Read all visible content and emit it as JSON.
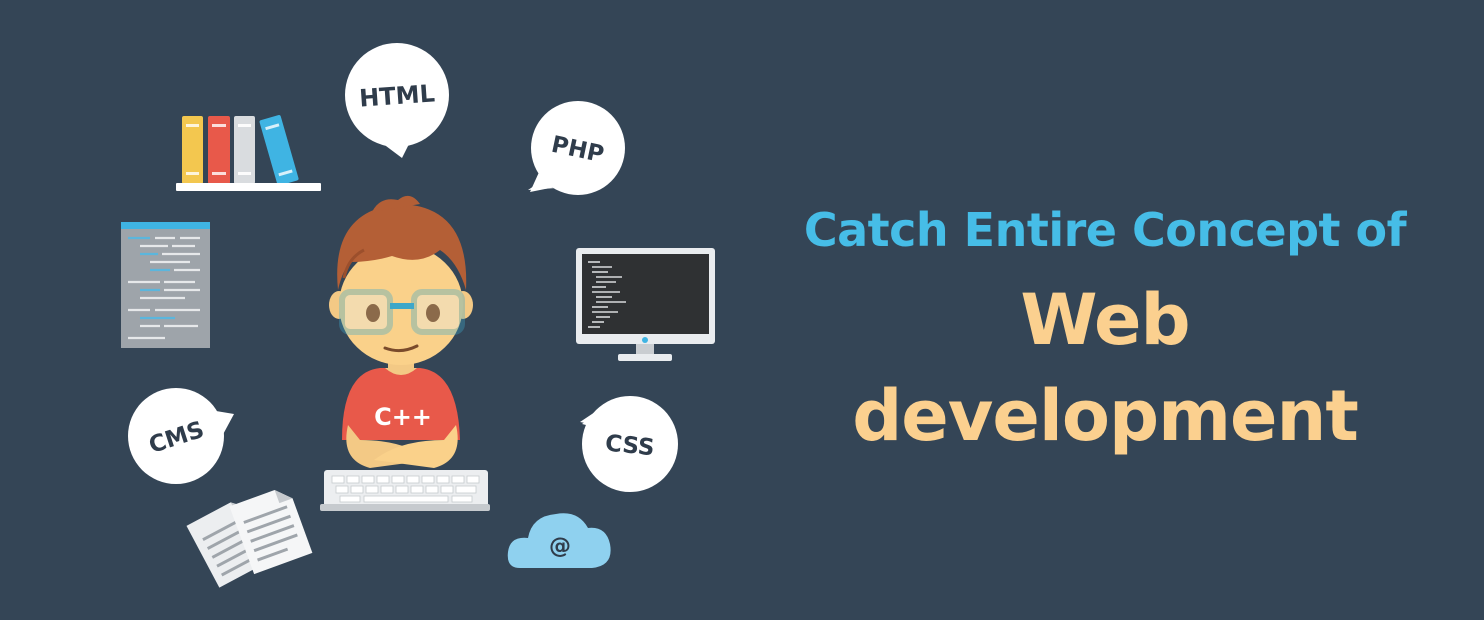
{
  "headline": {
    "subtitle": "Catch Entire Concept of",
    "title": "Web development"
  },
  "bubbles": {
    "html": "HTML",
    "php": "PHP",
    "css": "CSS",
    "cms": "CMS"
  },
  "character": {
    "shirt_text": "C++"
  },
  "cloud": {
    "symbol": "@"
  },
  "icons": [
    "book-shelf-icon",
    "code-document-icon",
    "monitor-code-icon",
    "keyboard-icon",
    "papers-icon",
    "cloud-email-icon",
    "speech-bubble-icon"
  ],
  "colors": {
    "background": "#344556",
    "subtitle": "#46bde7",
    "title": "#fbd08f",
    "bubble": "#ffffff",
    "bubble_text": "#2f3c4b"
  }
}
